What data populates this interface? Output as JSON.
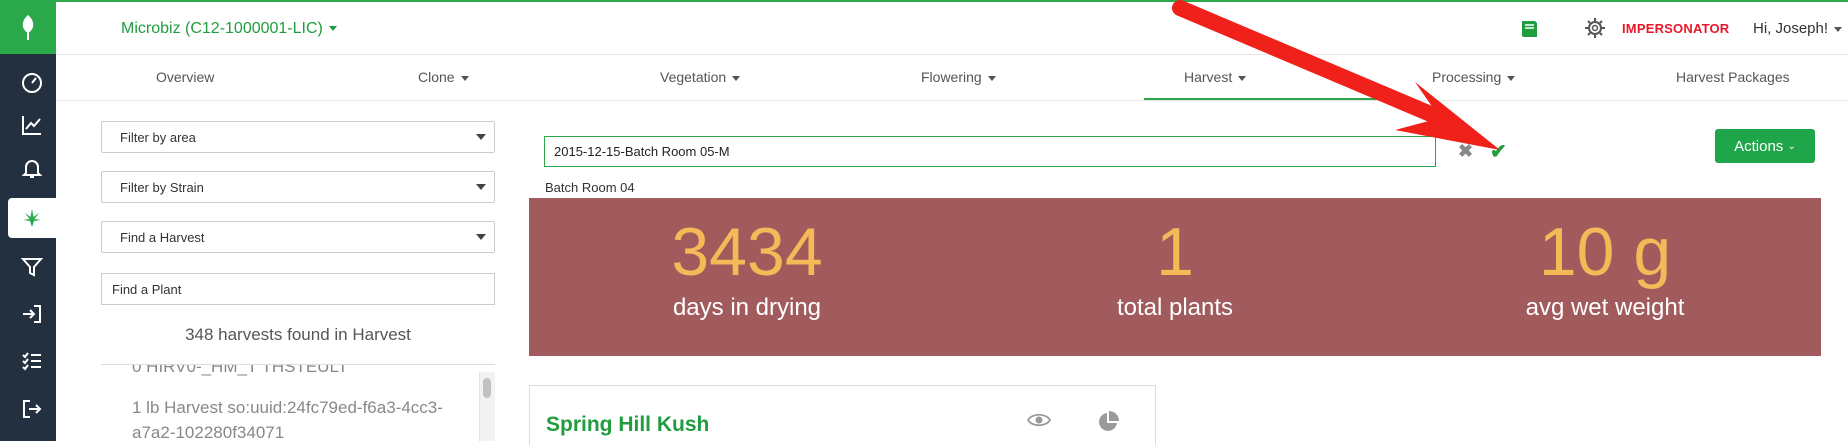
{
  "org": {
    "label": "Microbiz (C12-1000001-LIC)"
  },
  "header": {
    "impersonator": "IMPERSONATOR",
    "greeting": "Hi, Joseph!"
  },
  "tabs": [
    {
      "label": "Overview"
    },
    {
      "label": "Clone"
    },
    {
      "label": "Vegetation"
    },
    {
      "label": "Flowering"
    },
    {
      "label": "Harvest"
    },
    {
      "label": "Processing"
    },
    {
      "label": "Harvest Packages"
    }
  ],
  "filters": {
    "area": "Filter by area",
    "strain": "Filter by Strain",
    "harvest": "Find a Harvest",
    "plant_placeholder": "Find a Plant",
    "found_text": "348 harvests found in Harvest"
  },
  "list": {
    "partial": "0 HIRV0-_HM_T THSTEULT",
    "item": "1 lb Harvest so:uuid:24fc79ed-f6a3-4cc3-a7a2-102280f34071"
  },
  "edit": {
    "value": "2015-12-15-Batch Room 05-M",
    "parent_room": "Batch Room 04"
  },
  "actions": {
    "label": "Actions"
  },
  "stats": [
    {
      "value": "3434",
      "label": "days in drying"
    },
    {
      "value": "1",
      "label": "total plants"
    },
    {
      "value": "10 g",
      "label": "avg wet weight"
    }
  ],
  "card": {
    "strain": "Spring Hill Kush"
  },
  "colors": {
    "brand_green": "#2aa84a",
    "rail": "#223040",
    "stats_bg": "#a15b5c",
    "stat_value": "#f6b957",
    "danger": "#e8172a"
  }
}
